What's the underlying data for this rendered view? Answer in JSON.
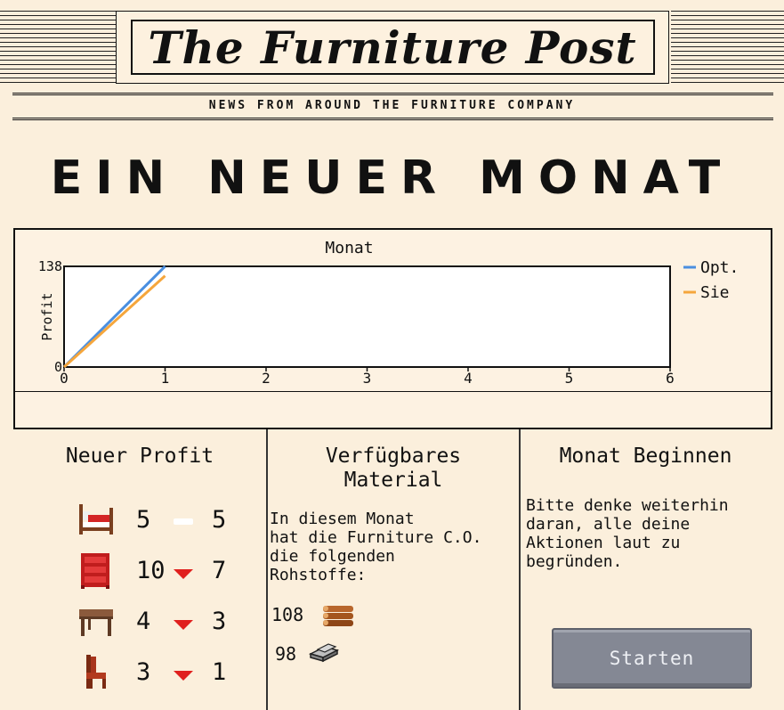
{
  "masthead": {
    "title": "The Furniture Post",
    "tagline": "NEWS FROM AROUND THE FURNITURE COMPANY"
  },
  "headline": "EIN NEUER MONAT",
  "chart_data": {
    "type": "line",
    "title": "Monat",
    "xlabel": "",
    "ylabel": "Profit",
    "xlim": [
      0,
      6
    ],
    "ylim": [
      0,
      138
    ],
    "x_ticks": [
      "0",
      "1",
      "2",
      "3",
      "4",
      "5",
      "6"
    ],
    "y_ticks": [
      "0",
      "138"
    ],
    "series": [
      {
        "name": "Opt.",
        "color": "#4a8fe0",
        "x": [
          0,
          1
        ],
        "y": [
          0,
          138
        ]
      },
      {
        "name": "Sie",
        "color": "#f5a63c",
        "x": [
          0,
          1
        ],
        "y": [
          0,
          125
        ]
      }
    ],
    "legend": "right",
    "grid": false
  },
  "profit": {
    "title": "Neuer Profit",
    "rows": [
      {
        "icon": "bed-icon",
        "old": "5",
        "new": "5",
        "trend": "equal"
      },
      {
        "icon": "shelf-icon",
        "old": "10",
        "new": "7",
        "trend": "down"
      },
      {
        "icon": "table-icon",
        "old": "4",
        "new": "3",
        "trend": "down"
      },
      {
        "icon": "chair-icon",
        "old": "3",
        "new": "1",
        "trend": "down"
      }
    ]
  },
  "material": {
    "title_line1": "Verfügbares",
    "title_line2": "Material",
    "text": "In diesem Monat\nhat die Furniture C.O.\ndie folgenden\nRohstoffe:",
    "wood": {
      "value": "108",
      "icon": "wood-logs-icon"
    },
    "metal": {
      "value": "98",
      "icon": "metal-bars-icon"
    }
  },
  "start": {
    "title": "Monat Beginnen",
    "text": "Bitte denke weiterhin\ndaran, alle deine\nAktionen laut zu\nbegründen.",
    "button_label": "Starten"
  },
  "colors": {
    "paper": "#fbefdc",
    "button": "#848894",
    "down_arrow": "#e0201e"
  }
}
